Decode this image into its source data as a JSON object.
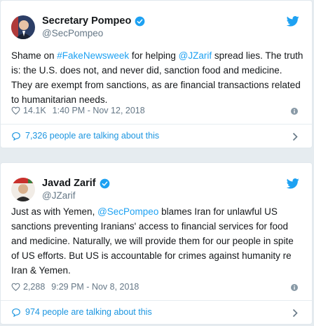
{
  "tweets": [
    {
      "display_name": "Secretary Pompeo",
      "handle": "@SecPompeo",
      "text_parts": [
        {
          "t": "Shame on ",
          "tag": false
        },
        {
          "t": "#FakeNewsweek",
          "tag": true
        },
        {
          "t": " for helping ",
          "tag": false
        },
        {
          "t": "@JZarif",
          "tag": true
        },
        {
          "t": " spread lies. The truth is: the U.S. does not, and never did, sanction food and medicine. They are exempt from sanctions, as are financial transactions related to humanitarian needs.",
          "tag": false
        }
      ],
      "likes": "14.1K",
      "timestamp": "1:40 PM - Nov 12, 2018",
      "talking": "7,326 people are talking about this"
    },
    {
      "display_name": "Javad Zarif",
      "handle": "@JZarif",
      "text_parts": [
        {
          "t": "Just as with Yemen, ",
          "tag": false
        },
        {
          "t": "@SecPompeo",
          "tag": true
        },
        {
          "t": " blames Iran for unlawful US sanctions preventing Iranians' access to financial services for food and medicine.  Naturally, we will provide them for our people in spite of US efforts. But US is accountable for crimes against humanity re Iran & Yemen.",
          "tag": false
        }
      ],
      "likes": "2,288",
      "timestamp": "9:29 PM - Nov 8, 2018",
      "talking": "974 people are talking about this"
    }
  ],
  "icons": {
    "verified": "verified-badge-icon",
    "bird": "twitter-bird-icon",
    "heart": "heart-icon",
    "info": "info-icon",
    "bubble": "comment-bubble-icon",
    "chevron": "chevron-right-icon"
  },
  "colors": {
    "link": "#1da1f2",
    "muted": "#657786",
    "text": "#14171a",
    "background": "#e6ecf0"
  }
}
